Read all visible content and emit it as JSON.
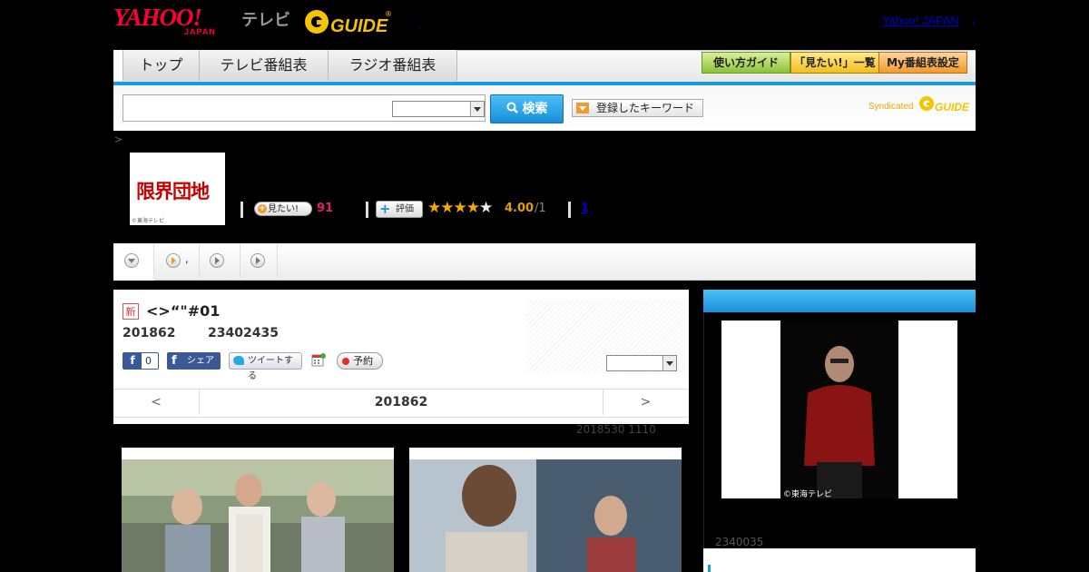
{
  "header": {
    "yahoo_logo": "YAHOO!",
    "yahoo_sub": "JAPAN",
    "tv_label": "テレビ",
    "gguide_logo": "GUIDE",
    "yj_link": "Yahoo! JAPAN",
    "yj_trailing": ",",
    "tiny_mark": ","
  },
  "nav": {
    "tabs": [
      {
        "label": "トップ"
      },
      {
        "label": "テレビ番組表"
      },
      {
        "label": "ラジオ番組表"
      }
    ],
    "right_buttons": [
      {
        "label": "使い方ガイド"
      },
      {
        "label": "「見たい!」一覧"
      },
      {
        "label": "My番組表設定"
      }
    ]
  },
  "search": {
    "input_value": "",
    "select_value": "",
    "button_label": "検索",
    "keyword_button": "登録したキーワード",
    "syndicated": "Syndicated",
    "synd_logo": "GUIDE"
  },
  "breadcrumb": ">",
  "program": {
    "thumb_title": "限界団地",
    "thumb_copy": "©東海テレビ",
    "mitai_label": "見たい!",
    "mitai_count": "91",
    "hyoka_label": "評価",
    "stars": "★★★★",
    "star_half": "★",
    "rating": "4.00",
    "rating_den": "/1",
    "review_count": "1"
  },
  "filter_tabs": [
    {
      "label": ""
    },
    {
      "label": ","
    },
    {
      "label": ""
    },
    {
      "label": ""
    }
  ],
  "episode": {
    "new_badge": "新",
    "title": "<>“\"#01",
    "date": "201862",
    "code": "23402435",
    "like_count": "0",
    "share_label": "シェア",
    "tweet_label": "ツイートする",
    "reserve_label": "予約",
    "select_value": ""
  },
  "pager": {
    "prev": "<",
    "current": "201862",
    "next": ">"
  },
  "update_note": "2018530  1110",
  "side": {
    "image_copy": "©東海テレビ",
    "id": "2340035"
  },
  "colors": {
    "accent_blue": "#1a9be0",
    "yahoo_red": "#ff0033",
    "star": "#f5a800",
    "mitai_count": "#e0206a"
  }
}
